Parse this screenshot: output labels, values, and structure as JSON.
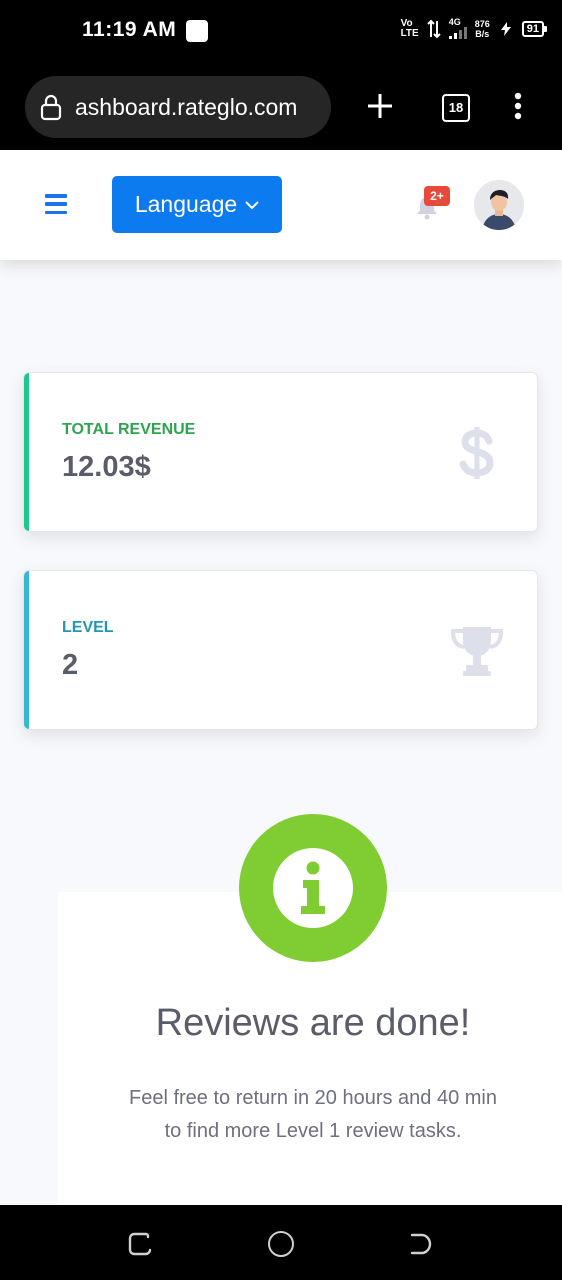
{
  "status_bar": {
    "time": "11:19 AM",
    "volte_top": "Vo",
    "volte_bottom": "LTE",
    "network": "4G",
    "speed_value": "876",
    "speed_unit": "B/s",
    "battery": "91"
  },
  "browser": {
    "url": "ashboard.rateglo.com",
    "tab_count": "18"
  },
  "topbar": {
    "language_label": "Language",
    "notification_badge": "2+"
  },
  "cards": [
    {
      "label": "TOTAL REVENUE",
      "value": "12.03$",
      "icon": "dollar-icon",
      "accent": "#1cc88a"
    },
    {
      "label": "LEVEL",
      "value": "2",
      "icon": "trophy-icon",
      "accent": "#36b9cc"
    }
  ],
  "info": {
    "icon": "info-icon",
    "title": "Reviews are done!",
    "message": "Feel free to return in 20 hours and 40 min to find more Level 1 review tasks.",
    "accent": "#7fcd32"
  }
}
